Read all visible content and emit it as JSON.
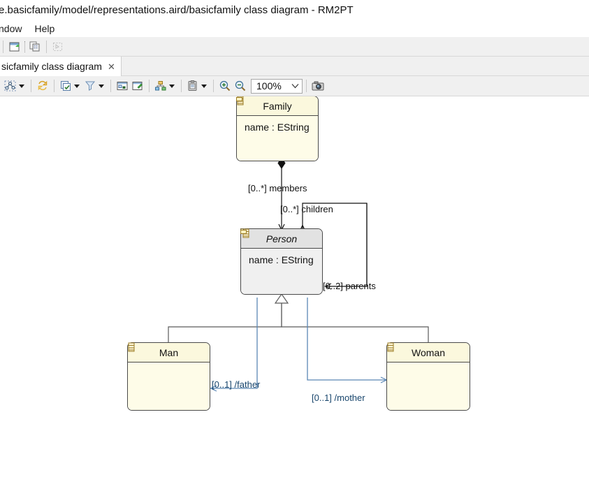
{
  "window": {
    "title": "e.basicfamily/model/representations.aird/basicfamily class diagram - RM2PT"
  },
  "menubar": {
    "items": [
      {
        "label": "ndow",
        "name": "menu-window"
      },
      {
        "label": "Help",
        "name": "menu-help"
      }
    ]
  },
  "main_toolbar": {
    "buttons": [
      {
        "name": "new-wizard-button",
        "icon": "new-document-icon",
        "enabled": true
      },
      {
        "name": "copy-button",
        "icon": "copy-icon",
        "enabled": true
      },
      {
        "name": "select-all-button",
        "icon": "marquee-select-icon",
        "enabled": false
      }
    ]
  },
  "tab": {
    "label": "sicfamily class diagram",
    "close_glyph": "✕",
    "active": true
  },
  "diagram_toolbar": {
    "buttons": [
      {
        "name": "layout-button",
        "icon": "layout-nodes-icon",
        "has_dropdown": true
      },
      {
        "name": "refresh-button",
        "icon": "refresh-arrows-icon",
        "has_dropdown": false
      },
      {
        "name": "select-layers-button",
        "icon": "layers-icon",
        "has_dropdown": true
      },
      {
        "name": "filter-button",
        "icon": "funnel-filter-icon",
        "has_dropdown": true
      },
      {
        "name": "show-hide-button",
        "icon": "diagram-window-icon",
        "has_dropdown": false
      },
      {
        "name": "pin-elements-button",
        "icon": "pin-diagram-icon",
        "has_dropdown": false
      },
      {
        "name": "arrange-button",
        "icon": "hierarchy-icon",
        "has_dropdown": true
      },
      {
        "name": "paste-format-button",
        "icon": "clipboard-format-icon",
        "has_dropdown": true
      },
      {
        "name": "zoom-in-button",
        "icon": "zoom-in-icon",
        "has_dropdown": false
      },
      {
        "name": "zoom-out-button",
        "icon": "zoom-out-icon",
        "has_dropdown": false
      },
      {
        "name": "capture-image-button",
        "icon": "camera-icon",
        "has_dropdown": false
      }
    ],
    "zoom": {
      "value": "100%",
      "chevron": "∨"
    }
  },
  "diagram": {
    "classes": [
      {
        "name": "Family",
        "id": "family",
        "abstract": false,
        "icon": "uml-class-icon",
        "fill": "#fefce8",
        "attributes": [
          {
            "label": "name : EString",
            "icon": "attribute-icon"
          }
        ]
      },
      {
        "name": "Person",
        "id": "person",
        "abstract": true,
        "icon": "uml-abstract-class-icon",
        "fill": "#f0f0f0",
        "attributes": [
          {
            "label": "name : EString",
            "icon": "attribute-icon"
          }
        ]
      },
      {
        "name": "Man",
        "id": "man",
        "abstract": false,
        "icon": "uml-class-icon",
        "fill": "#fefce8",
        "attributes": []
      },
      {
        "name": "Woman",
        "id": "woman",
        "abstract": false,
        "icon": "uml-class-icon",
        "fill": "#fefce8",
        "attributes": []
      }
    ],
    "associations": [
      {
        "id": "members",
        "label": "[0..*] members",
        "multiplicity": "[0..*]",
        "role": "members",
        "from": "Family",
        "to": "Person",
        "kind": "composition",
        "color": "#111111"
      },
      {
        "id": "children",
        "label": "[0..*] children",
        "multiplicity": "[0..*]",
        "role": "children",
        "from": "Person",
        "to": "Person",
        "kind": "association",
        "color": "#111111"
      },
      {
        "id": "parents",
        "label": "[0..2] parents",
        "multiplicity": "[0..2]",
        "role": "parents",
        "from": "Person",
        "to": "Person",
        "kind": "association",
        "color": "#111111"
      },
      {
        "id": "father",
        "label": "[0..1] /father",
        "multiplicity": "[0..1]",
        "role": "/father",
        "from": "Person",
        "to": "Man",
        "kind": "derived",
        "color": "#5b87b5"
      },
      {
        "id": "mother",
        "label": "[0..1] /mother",
        "multiplicity": "[0..1]",
        "role": "/mother",
        "from": "Person",
        "to": "Woman",
        "kind": "derived",
        "color": "#5b87b5"
      }
    ],
    "generalizations": [
      {
        "id": "man-person",
        "from": "Man",
        "to": "Person"
      },
      {
        "id": "woman-person",
        "from": "Woman",
        "to": "Person"
      }
    ]
  },
  "colors": {
    "class_fill_cream": "#fefce8",
    "class_fill_cream_header": "#fbf8dd",
    "class_fill_gray": "#f0f0f0",
    "class_border": "#4a4a4a",
    "edge_black": "#111111",
    "edge_blue": "#5b87b5",
    "toolbar_bg": "#f0f0f0"
  }
}
